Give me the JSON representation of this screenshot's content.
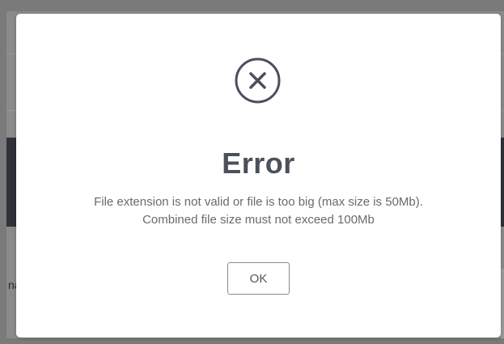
{
  "background": {
    "partial_text": "na"
  },
  "dialog": {
    "icon": "close-circle-icon",
    "title": "Error",
    "message_line1": "File extension is not valid or file is too big (max size is 50Mb).",
    "message_line2": "Combined file size must not exceed 100Mb",
    "ok_label": "OK"
  },
  "colors": {
    "overlay": "#8a8a8a",
    "dialog_bg": "#ffffff",
    "title": "#4a505c",
    "message": "#6a6a6a",
    "icon": "#4a505c"
  }
}
